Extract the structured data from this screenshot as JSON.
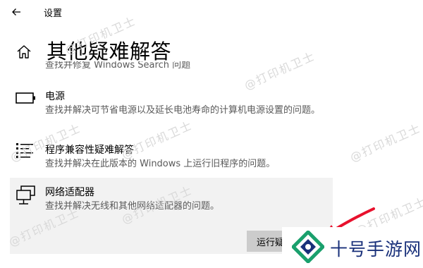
{
  "window": {
    "title": "设置"
  },
  "header": {
    "title": "其他疑难解答"
  },
  "items": [
    {
      "name": "",
      "desc": "查找并修复 Windows Search 问题"
    },
    {
      "name": "电源",
      "desc": "查找并解决可节省电源以及延长电池寿命的计算机电源设置的问题。",
      "icon": "battery-icon"
    },
    {
      "name": "程序兼容性疑难解答",
      "desc": "查找并解决在此版本的 Windows 上运行旧程序的问题。",
      "icon": "list-icon"
    },
    {
      "name": "网络适配器",
      "desc": "查找并解决无线和其他网络适配器的问题。",
      "icon": "network-adapter-icon"
    }
  ],
  "run_button": "运行疑",
  "watermark": "@打印机卫士",
  "brand": {
    "name": "十号手游网"
  },
  "colors": {
    "arrow": "#e8112d",
    "brand_text": "#19307a",
    "brand_green": "#1aa06d",
    "selected_bg": "#f2f2f2",
    "button_bg": "#cccccc"
  }
}
